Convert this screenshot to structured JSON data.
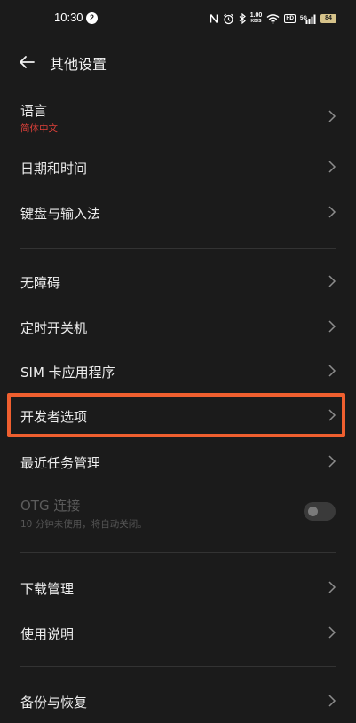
{
  "status_bar": {
    "time": "10:30",
    "notification_count": "2",
    "speed_value": "1.00",
    "speed_unit": "KB/S",
    "hd_label": "HD",
    "network_label": "5G",
    "battery_level": "84"
  },
  "header": {
    "title": "其他设置"
  },
  "items": {
    "language": {
      "label": "语言",
      "value": "简体中文",
      "value_color": "#e0413a"
    },
    "datetime": {
      "label": "日期和时间"
    },
    "keyboard": {
      "label": "键盘与输入法"
    },
    "accessibility": {
      "label": "无障碍"
    },
    "schedule_power": {
      "label": "定时开关机"
    },
    "sim_apps": {
      "label": "SIM 卡应用程序"
    },
    "developer": {
      "label": "开发者选项"
    },
    "recent_tasks": {
      "label": "最近任务管理"
    },
    "otg": {
      "label": "OTG 连接",
      "description": "10 分钟未使用，将自动关闭。",
      "enabled": false
    },
    "downloads": {
      "label": "下载管理"
    },
    "manual": {
      "label": "使用说明"
    },
    "backup": {
      "label": "备份与恢复"
    }
  },
  "highlight_color": "#ef5f2f"
}
